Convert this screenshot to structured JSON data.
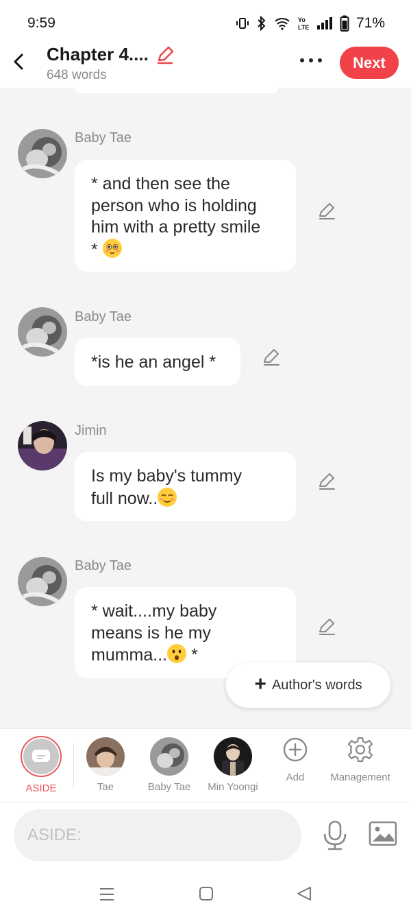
{
  "status_bar": {
    "time": "9:59",
    "battery": "71%"
  },
  "header": {
    "title": "Chapter 4....",
    "word_count": "648 words",
    "next_label": "Next"
  },
  "messages": [
    {
      "sender": "Baby Tae",
      "text_lines": [
        "* and then see the",
        "person who is holding",
        "him with a pretty smile",
        "* "
      ],
      "emoji": "flushed-face"
    },
    {
      "sender": "Baby Tae",
      "text": "*is he an angel *"
    },
    {
      "sender": "Jimin",
      "text_lines": [
        "Is my baby's tummy",
        "full now.."
      ],
      "emoji": "smiling-face"
    },
    {
      "sender": "Baby Tae",
      "text_lines": [
        "* wait....my baby",
        "means is he my",
        "mumma...",
        " *"
      ],
      "emoji": "hushed-face"
    }
  ],
  "authors_words": {
    "label": "Author's words"
  },
  "characters": [
    {
      "name": "ASIDE",
      "active": true
    },
    {
      "name": "Tae"
    },
    {
      "name": "Baby Tae"
    },
    {
      "name": "Min Yoongi"
    },
    {
      "name": "Add"
    },
    {
      "name": "Management"
    }
  ],
  "input": {
    "placeholder": "ASIDE:"
  },
  "colors": {
    "accent": "#f04248",
    "aside_ring": "#e8585c",
    "background": "#f4f4f4"
  }
}
